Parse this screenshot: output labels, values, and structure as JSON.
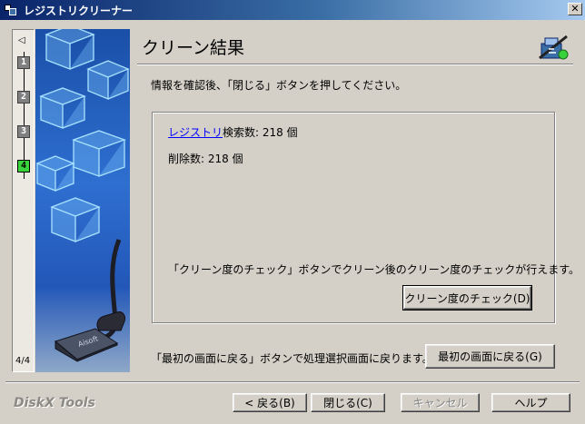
{
  "window": {
    "title": "レジストリクリーナー",
    "close_symbol": "✕"
  },
  "steps": {
    "items": [
      "1",
      "2",
      "3",
      "4"
    ],
    "active": 4,
    "counter": "4/4",
    "arrow": "◁"
  },
  "header": {
    "title": "クリーン結果"
  },
  "instruction": "情報を確認後、「閉じる」ボタンを押してください。",
  "results": {
    "registry_link": "レジストリ",
    "search_count": "検索数: 218 個",
    "deleted_count": "削除数: 218 個",
    "check_note": "「クリーン度のチェック」ボタンでクリーン後のクリーン度のチェックが行えます。",
    "check_button": "クリーン度のチェック(D)"
  },
  "return_note": "「最初の画面に戻る」ボタンで処理選択画面に戻ります。",
  "return_button": "最初の画面に戻る(G)",
  "footer": {
    "brand": "DiskX Tools",
    "back": "< 戻る(B)",
    "close": "閉じる(C)",
    "cancel": "キャンセル",
    "help": "ヘルプ"
  },
  "colors": {
    "title_bar": "#0a246a",
    "step_active": "#38d23a",
    "link": "#0000ff"
  }
}
